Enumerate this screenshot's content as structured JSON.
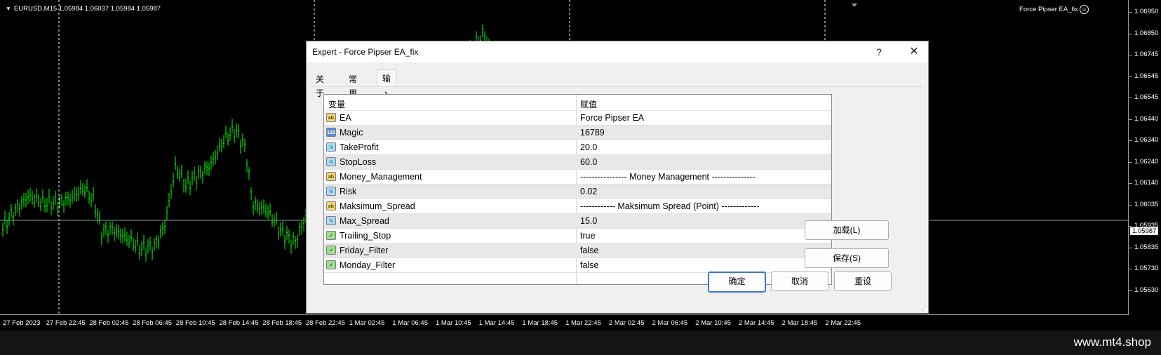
{
  "chart": {
    "symbol_info": "EURUSD,M15  1.05984 1.06037 1.05984 1.05987",
    "ea_label": "Force Pipser EA_fix",
    "colors": {
      "background": "#000000",
      "candles": "#00ff00",
      "bid_line": "#8a9aa8",
      "text": "#ffffff"
    },
    "price_levels": [
      "1.06950",
      "1.06850",
      "1.06745",
      "1.06645",
      "1.06545",
      "1.06440",
      "1.06340",
      "1.06240",
      "1.06140",
      "1.06035",
      "1.05935",
      "1.05835",
      "1.05730",
      "1.05630"
    ],
    "current_price": "1.05987",
    "time_labels": [
      "27 Feb 2023",
      "27 Feb 22:45",
      "28 Feb 02:45",
      "28 Feb 06:45",
      "28 Feb 10:45",
      "28 Feb 14:45",
      "28 Feb 18:45",
      "28 Feb 22:45",
      "1 Mar 02:45",
      "1 Mar 06:45",
      "1 Mar 10:45",
      "1 Mar 14:45",
      "1 Mar 18:45",
      "1 Mar 22:45",
      "2 Mar 02:45",
      "2 Mar 06:45",
      "2 Mar 10:45",
      "2 Mar 14:45",
      "2 Mar 18:45",
      "2 Mar 22:45"
    ]
  },
  "watermark": "www.mt4.shop",
  "dialog": {
    "title": "Expert - Force Pipser EA_fix",
    "help": "?",
    "close": "✕",
    "tabs": [
      {
        "label": "关于",
        "active": false
      },
      {
        "label": "常用",
        "active": false
      },
      {
        "label": "输入参数",
        "active": true
      }
    ],
    "grid": {
      "col_variable": "变量",
      "col_value": "赋值",
      "rows": [
        {
          "icon": "ab",
          "name": "EA",
          "value": "Force Pipser EA"
        },
        {
          "icon": "123",
          "name": "Magic",
          "value": "16789"
        },
        {
          "icon": "½",
          "name": "TakeProfit",
          "value": "20.0"
        },
        {
          "icon": "½",
          "name": "StopLoss",
          "value": "60.0"
        },
        {
          "icon": "ab",
          "name": "Money_Management",
          "value": "---------------- Money Management  ---------------"
        },
        {
          "icon": "½",
          "name": "Risk",
          "value": "0.02"
        },
        {
          "icon": "ab",
          "name": "Maksimum_Spread",
          "value": "------------ Maksimum Spread (Point) -------------"
        },
        {
          "icon": "½",
          "name": "Max_Spread",
          "value": "15.0"
        },
        {
          "icon": "✓",
          "name": "Trailing_Stop",
          "value": "true"
        },
        {
          "icon": "✓",
          "name": "Friday_Filter",
          "value": "false"
        },
        {
          "icon": "✓",
          "name": "Monday_Filter",
          "value": "false"
        }
      ]
    },
    "buttons": {
      "load": "加载(L)",
      "save": "保存(S)",
      "ok": "确定",
      "cancel": "取消",
      "reset": "重设"
    }
  }
}
